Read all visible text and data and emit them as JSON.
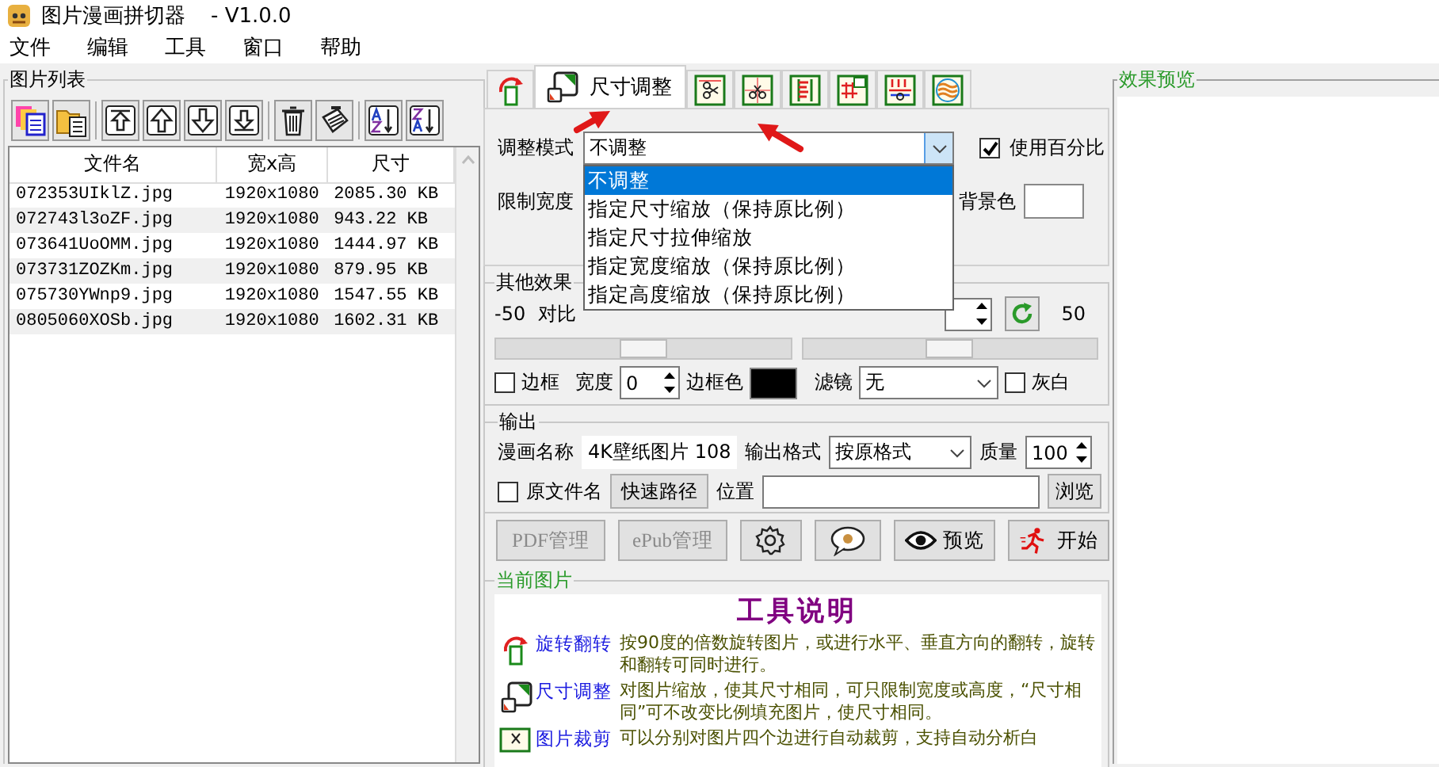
{
  "window": {
    "title": "图片漫画拼切器",
    "version": "- V1.0.0"
  },
  "menu": [
    "文件",
    "编辑",
    "工具",
    "窗口",
    "帮助"
  ],
  "image_list": {
    "title": "图片列表",
    "toolbar": [
      {
        "kind": "copy"
      },
      {
        "kind": "folder"
      },
      {
        "kind": "top"
      },
      {
        "kind": "up"
      },
      {
        "kind": "down"
      },
      {
        "kind": "bottom"
      },
      {
        "kind": "delete"
      },
      {
        "kind": "clear"
      },
      {
        "kind": "sort_az"
      },
      {
        "kind": "sort_za"
      }
    ],
    "columns": [
      "文件名",
      "宽x高",
      "尺寸"
    ],
    "rows": [
      [
        "072353UIklZ.jpg",
        "1920x1080",
        "2085.30 KB"
      ],
      [
        "072743l3oZF.jpg",
        "1920x1080",
        "943.22 KB"
      ],
      [
        "073641UoOMM.jpg",
        "1920x1080",
        "1444.97 KB"
      ],
      [
        "073731ZOZKm.jpg",
        "1920x1080",
        "879.95 KB"
      ],
      [
        "075730YWnp9.jpg",
        "1920x1080",
        "1547.55 KB"
      ],
      [
        "0805060XOSb.jpg",
        "1920x1080",
        "1602.31 KB"
      ]
    ]
  },
  "tabs": [
    {
      "kind": "rotate",
      "selected": false
    },
    {
      "kind": "resize",
      "label": "尺寸调整",
      "selected": true
    },
    {
      "kind": "scissors",
      "selected": false
    },
    {
      "kind": "scissors2",
      "selected": false
    },
    {
      "kind": "ruler",
      "selected": false
    },
    {
      "kind": "split",
      "selected": false
    },
    {
      "kind": "grid",
      "selected": false
    },
    {
      "kind": "wave",
      "selected": false
    }
  ],
  "resize": {
    "mode_label": "调整模式",
    "mode_value": "不调整",
    "expanded": true,
    "use_percent": {
      "label": "使用百分比",
      "checked": true
    },
    "limit_label": "限制宽度",
    "bg_label": "背景色",
    "options": [
      {
        "label": "不调整",
        "selected": true
      },
      {
        "label": "指定尺寸缩放（保持原比例）",
        "selected": false
      },
      {
        "label": "指定尺寸拉伸缩放",
        "selected": false
      },
      {
        "label": "指定宽度缩放（保持原比例）",
        "selected": false
      },
      {
        "label": "指定高度缩放（保持原比例）",
        "selected": false
      }
    ]
  },
  "effects": {
    "title": "其他效果",
    "min": "-50",
    "contrast_label": "对比",
    "max": "50",
    "sliders": [
      {
        "level": 0.5
      },
      {
        "level": 0.5
      }
    ],
    "border": {
      "label": "边框",
      "checked": false
    },
    "width_label": "宽度",
    "width_value": "0",
    "border_color_label": "边框色",
    "filter_label": "滤镜",
    "filter_value": "无",
    "gray": {
      "label": "灰白",
      "checked": false
    }
  },
  "output": {
    "title": "输出",
    "name_label": "漫画名称",
    "name_value": "4K壁纸图片 108",
    "format_label": "输出格式",
    "format_value": "按原格式",
    "quality_label": "质量",
    "quality_value": "100",
    "original_name": {
      "label": "原文件名",
      "checked": false
    },
    "quick_path": "快速路径",
    "location_label": "位置",
    "browse": "浏览"
  },
  "actions": [
    {
      "kind": "pdf",
      "label": "PDF管理",
      "disabled": true
    },
    {
      "kind": "epub",
      "label": "ePub管理",
      "disabled": true
    },
    {
      "kind": "settings",
      "disabled": false
    },
    {
      "kind": "chat",
      "disabled": false
    },
    {
      "kind": "preview",
      "label": "预览",
      "disabled": false
    },
    {
      "kind": "start",
      "label": "开始",
      "disabled": false
    }
  ],
  "info": {
    "title": "当前图片",
    "heading": "工具说明",
    "items": [
      {
        "kind": "rotate",
        "name": "旋转翻转",
        "text": "按90度的倍数旋转图片，或进行水平、垂直方向的翻转，旋转和翻转可同时进行。"
      },
      {
        "kind": "resize",
        "name": "尺寸调整",
        "text": "对图片缩放，使其尺寸相同，可只限制宽度或高度，“尺寸相同”可不改变比例填充图片，使尺寸相同。"
      },
      {
        "kind": "crop",
        "name": "图片裁剪",
        "text": "可以分别对图片四个边进行自动裁剪，支持自动分析白"
      }
    ]
  },
  "preview": {
    "title": "效果预览"
  }
}
